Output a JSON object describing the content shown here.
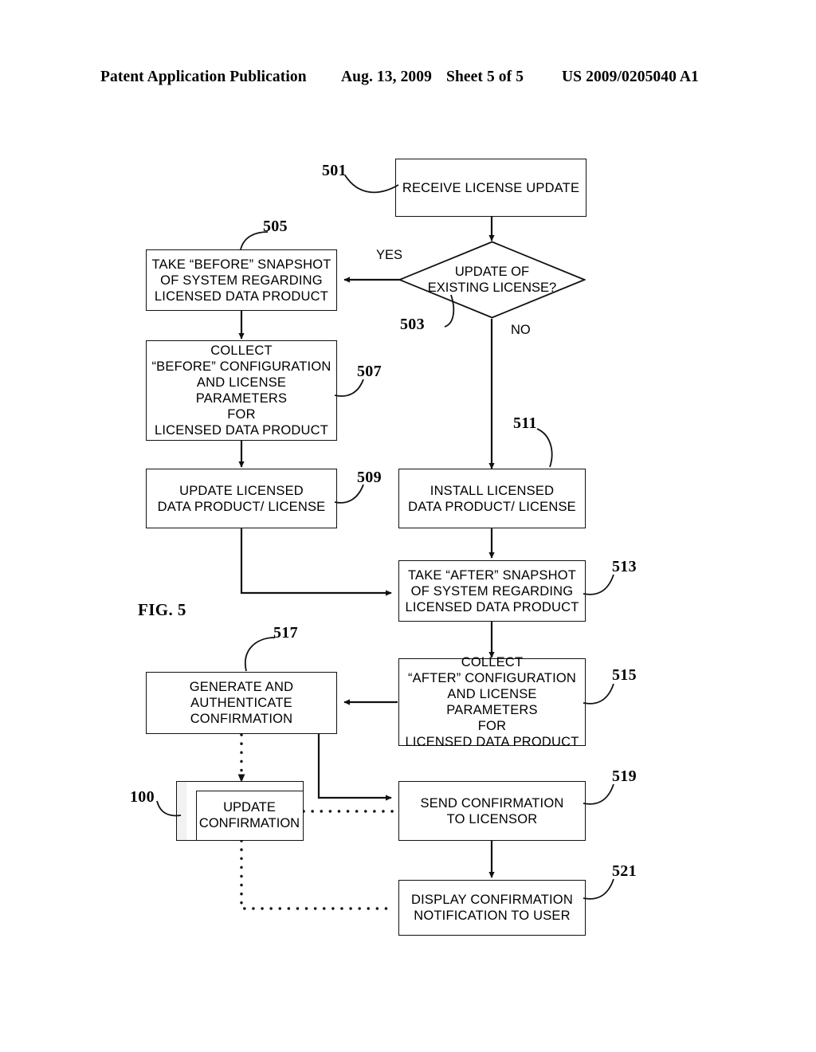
{
  "header": {
    "publication": "Patent Application Publication",
    "date": "Aug. 13, 2009",
    "sheet": "Sheet 5 of 5",
    "number": "US 2009/0205040 A1"
  },
  "figure": {
    "caption": "FIG. 5",
    "nodes": {
      "n501": {
        "ref": "501",
        "text": "RECEIVE LICENSE UPDATE"
      },
      "n503": {
        "ref": "503",
        "text": "UPDATE OF\nEXISTING LICENSE?"
      },
      "n505": {
        "ref": "505",
        "text": "TAKE “BEFORE” SNAPSHOT\nOF SYSTEM REGARDING\nLICENSED DATA PRODUCT"
      },
      "n507": {
        "ref": "507",
        "text": "COLLECT\n“BEFORE” CONFIGURATION\nAND LICENSE PARAMETERS\nFOR\nLICENSED DATA PRODUCT"
      },
      "n509": {
        "ref": "509",
        "text": "UPDATE LICENSED\nDATA PRODUCT/ LICENSE"
      },
      "n511": {
        "ref": "511",
        "text": "INSTALL LICENSED\nDATA PRODUCT/  LICENSE"
      },
      "n513": {
        "ref": "513",
        "text": "TAKE “AFTER” SNAPSHOT\nOF SYSTEM REGARDING\nLICENSED DATA PRODUCT"
      },
      "n515": {
        "ref": "515",
        "text": "COLLECT\n“AFTER” CONFIGURATION\nAND LICENSE PARAMETERS\nFOR\nLICENSED DATA PRODUCT"
      },
      "n517": {
        "ref": "517",
        "text": "GENERATE AND\nAUTHENTICATE\nCONFIRMATION"
      },
      "n100": {
        "ref": "100",
        "text": "UPDATE\nCONFIRMATION"
      },
      "n519": {
        "ref": "519",
        "text": "SEND CONFIRMATION\nTO LICENSOR"
      },
      "n521": {
        "ref": "521",
        "text": "DISPLAY CONFIRMATION\nNOTIFICATION TO USER"
      }
    },
    "edge_labels": {
      "yes": "YES",
      "no": "NO"
    },
    "colors": {
      "ink": "#111111",
      "paper": "#ffffff"
    }
  }
}
